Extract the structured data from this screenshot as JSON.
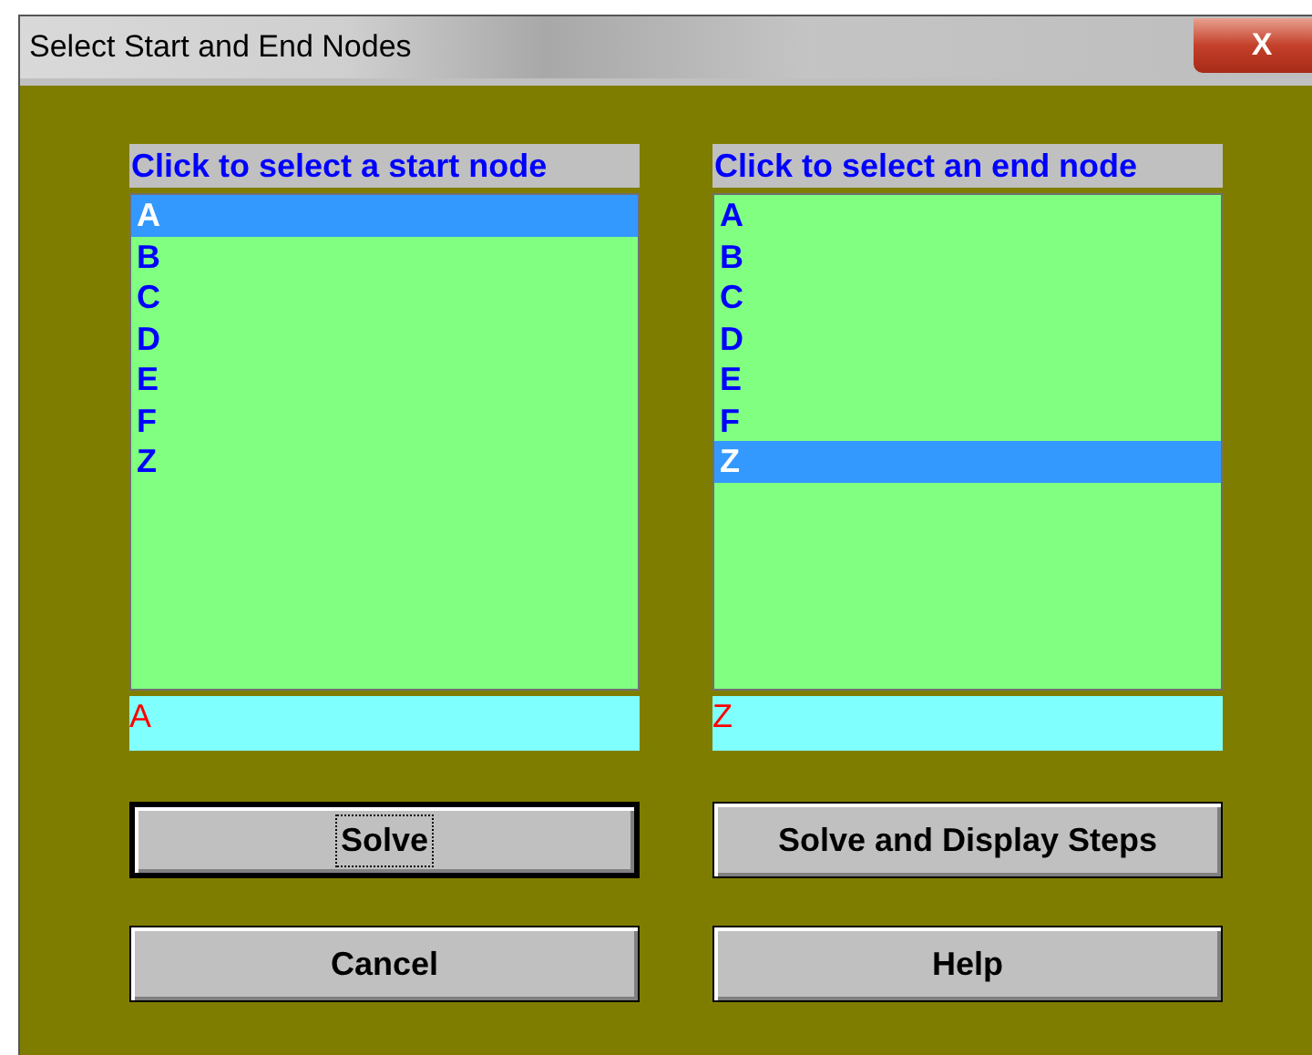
{
  "window": {
    "title": "Select Start and End Nodes",
    "close": "X"
  },
  "lists": [
    {
      "header": "Click to select a start node",
      "items": [
        {
          "label": "A",
          "selected": true
        },
        {
          "label": "B",
          "selected": false
        },
        {
          "label": "C",
          "selected": false
        },
        {
          "label": "D",
          "selected": false
        },
        {
          "label": "E",
          "selected": false
        },
        {
          "label": "F",
          "selected": false
        },
        {
          "label": "Z",
          "selected": false
        }
      ],
      "value": "A"
    },
    {
      "header": "Click to select an end node",
      "items": [
        {
          "label": "A",
          "selected": false
        },
        {
          "label": "B",
          "selected": false
        },
        {
          "label": "C",
          "selected": false
        },
        {
          "label": "D",
          "selected": false
        },
        {
          "label": "E",
          "selected": false
        },
        {
          "label": "F",
          "selected": false
        },
        {
          "label": "Z",
          "selected": true
        }
      ],
      "value": "Z"
    }
  ],
  "buttons": [
    {
      "label": "Solve",
      "default": true
    },
    {
      "label": "Solve and Display Steps",
      "default": false
    },
    {
      "label": "Cancel",
      "default": false
    },
    {
      "label": "Help",
      "default": false
    }
  ]
}
